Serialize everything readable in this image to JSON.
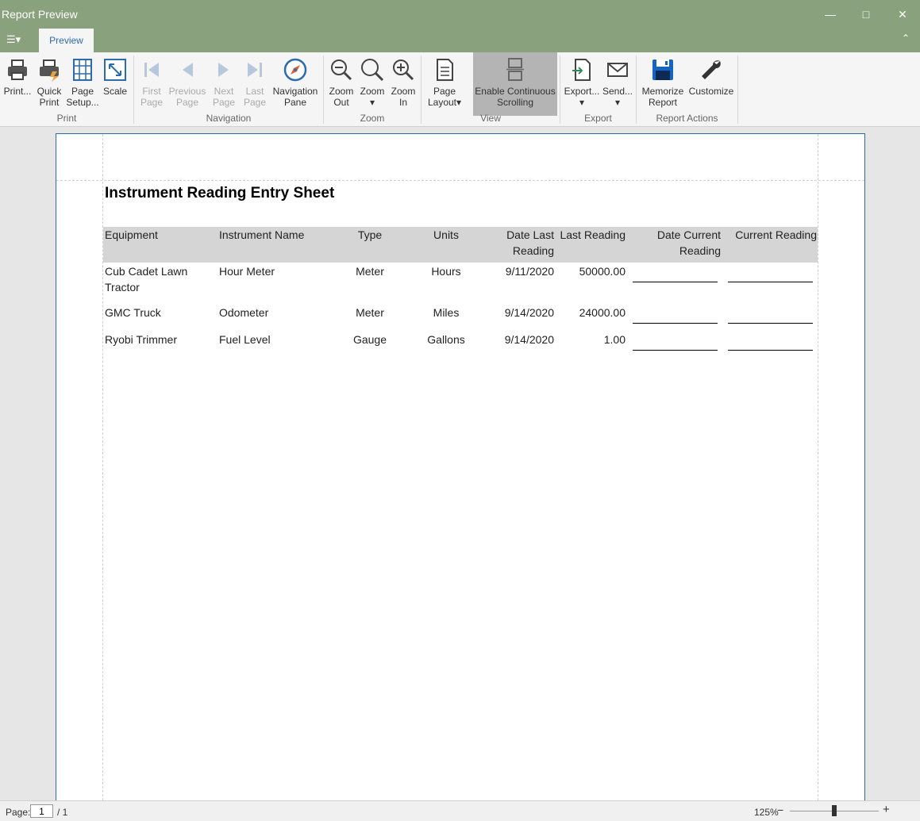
{
  "window": {
    "title": "Report Preview"
  },
  "tabs": [
    {
      "label": "Preview"
    }
  ],
  "ribbon": {
    "print": {
      "print": "Print...",
      "quick_print_1": "Quick",
      "quick_print_2": "Print",
      "page_setup_1": "Page",
      "page_setup_2": "Setup...",
      "scale": "Scale",
      "group": "Print"
    },
    "navigation": {
      "first_1": "First",
      "first_2": "Page",
      "prev_1": "Previous",
      "prev_2": "Page",
      "next_1": "Next",
      "next_2": "Page",
      "last_1": "Last",
      "last_2": "Page",
      "nav_pane_1": "Navigation",
      "nav_pane_2": "Pane",
      "group": "Navigation"
    },
    "zoom": {
      "zoom_out_1": "Zoom",
      "zoom_out_2": "Out",
      "zoom": "Zoom",
      "zoom_in_1": "Zoom",
      "zoom_in_2": "In",
      "group": "Zoom"
    },
    "view": {
      "page_layout_1": "Page",
      "page_layout_2": "Layout",
      "continuous_1": "Enable Continuous",
      "continuous_2": "Scrolling",
      "group": "View"
    },
    "export": {
      "export": "Export...",
      "send": "Send...",
      "group": "Export"
    },
    "actions": {
      "memorize_1": "Memorize",
      "memorize_2": "Report",
      "customize": "Customize",
      "group": "Report Actions"
    }
  },
  "report": {
    "title": "Instrument Reading Entry Sheet",
    "headers": {
      "equipment": "Equipment",
      "instrument": "Instrument Name",
      "type": "Type",
      "units": "Units",
      "date_last_1": "Date Last",
      "date_last_2": "Reading",
      "last_reading": "Last Reading",
      "date_current_1": "Date Current",
      "date_current_2": "Reading",
      "current_reading": "Current Reading"
    },
    "rows": [
      {
        "equipment_1": "Cub Cadet Lawn",
        "equipment_2": "Tractor",
        "instrument": "Hour Meter",
        "type": "Meter",
        "units": "Hours",
        "date_last": "9/11/2020",
        "last_reading": "50000.00"
      },
      {
        "equipment_1": "GMC Truck",
        "equipment_2": "",
        "instrument": "Odometer",
        "type": "Meter",
        "units": "Miles",
        "date_last": "9/14/2020",
        "last_reading": "24000.00"
      },
      {
        "equipment_1": "Ryobi Trimmer",
        "equipment_2": "",
        "instrument": "Fuel Level",
        "type": "Gauge",
        "units": "Gallons",
        "date_last": "9/14/2020",
        "last_reading": "1.00"
      }
    ]
  },
  "status": {
    "page_label": "Page:",
    "page_value": "1",
    "page_total": "/ 1",
    "zoom": "125%",
    "zoom_minus": "−",
    "zoom_plus": "+"
  },
  "zoom_level_fraction": 0.5
}
